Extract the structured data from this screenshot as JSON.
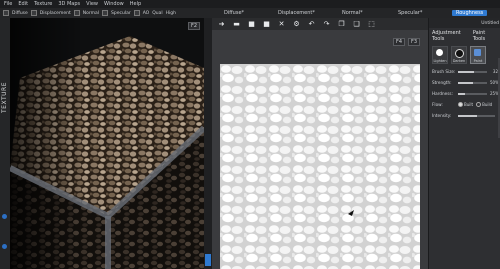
{
  "menu": [
    "File",
    "Edit",
    "Texture",
    "3D Maps",
    "View",
    "Window",
    "Help"
  ],
  "toolbar": {
    "checks": [
      {
        "label": "Diffuse",
        "checked": true
      },
      {
        "label": "Displacement",
        "checked": true
      },
      {
        "label": "Normal",
        "checked": true
      },
      {
        "label": "Specular",
        "checked": true
      },
      {
        "label": "AO",
        "checked": true
      }
    ],
    "quality_label": "Qual",
    "quality_value": "High"
  },
  "map_tabs": [
    "Diffuse*",
    "Displacement*",
    "Normal*",
    "Specular*",
    "Roughness"
  ],
  "side_label": "TEXTURE",
  "viewport_badge": "F2",
  "canvas_badges": [
    "F4",
    "F3"
  ],
  "right_toolbar_icons": [
    "arrow-right-icon",
    "folder-icon",
    "save-icon",
    "save-as-icon",
    "close-icon",
    "gear-icon",
    "undo-icon",
    "redo-icon",
    "copy-icon",
    "paste-icon",
    "fit-icon"
  ],
  "panel": {
    "tabs": [
      "Untitled"
    ],
    "title_left": "Adjustment Tools",
    "title_right": "Paint Tools",
    "tools": [
      {
        "label": "Lighten",
        "color": "#ffffff"
      },
      {
        "label": "Darken",
        "color": "#111111"
      },
      {
        "label": "Paint",
        "color": "#5b8fd6"
      }
    ],
    "props": [
      {
        "label": "Brush Size:",
        "value": "32",
        "fill": 0.55
      },
      {
        "label": "Strength:",
        "value": "50%",
        "fill": 0.5
      },
      {
        "label": "Hardness:",
        "value": "25%",
        "fill": 0.25
      }
    ],
    "flow_label": "Flow:",
    "flow_options": [
      "Built",
      "Build"
    ],
    "intensity_label": "Intensity:",
    "intensity_fill": 0.5
  }
}
